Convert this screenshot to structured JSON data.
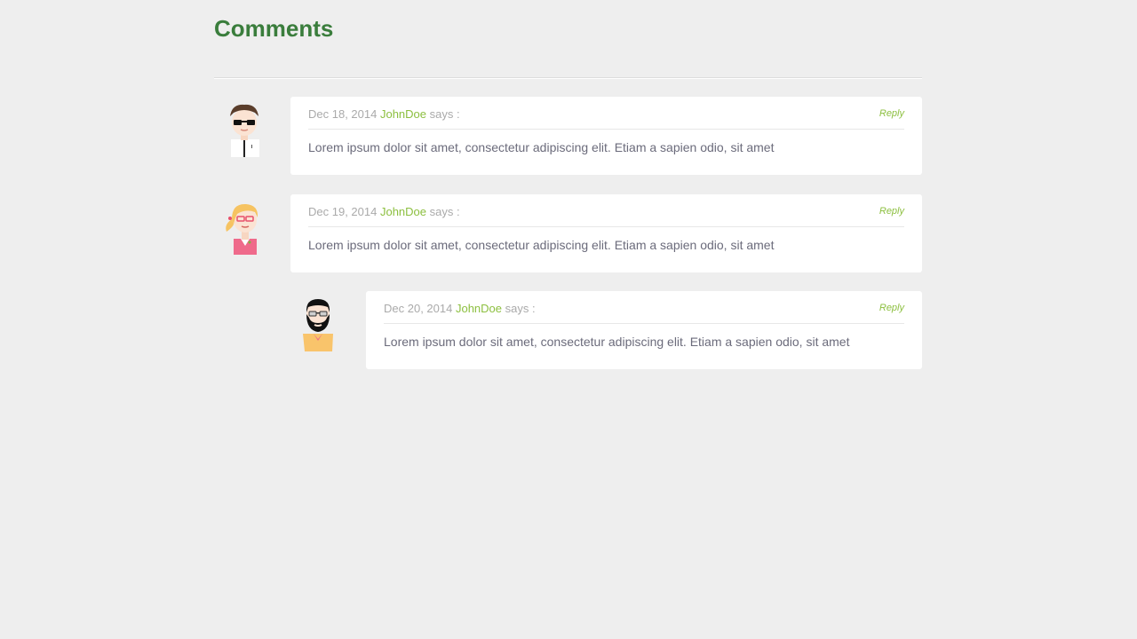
{
  "page": {
    "title": "Comments"
  },
  "comments": [
    {
      "date": "Dec 18, 2014",
      "author": "JohnDoe",
      "says": "says :",
      "reply": "Reply",
      "text": "Lorem ipsum dolor sit amet, consectetur adipiscing elit. Etiam a sapien odio, sit amet",
      "avatar_icon": "man-sunglasses-icon"
    },
    {
      "date": "Dec 19, 2014",
      "author": "JohnDoe",
      "says": "says :",
      "reply": "Reply",
      "text": "Lorem ipsum dolor sit amet, consectetur adipiscing elit. Etiam a sapien odio, sit amet",
      "avatar_icon": "woman-glasses-icon"
    },
    {
      "date": "Dec 20, 2014",
      "author": "JohnDoe",
      "says": "says :",
      "reply": "Reply",
      "text": "Lorem ipsum dolor sit amet, consectetur adipiscing elit. Etiam a sapien odio, sit amet",
      "avatar_icon": "bearded-man-icon"
    }
  ],
  "colors": {
    "title": "#3a7d3c",
    "author": "#8cbf3f",
    "meta": "#aaaaaa",
    "body_text": "#6b6b7b",
    "background": "#eeeeee"
  }
}
